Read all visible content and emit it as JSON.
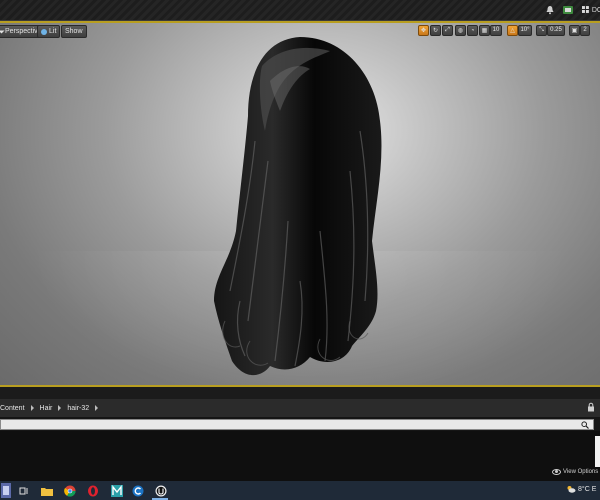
{
  "topbar": {
    "icons": [
      "bell-icon",
      "source-control-icon",
      "layout-icon"
    ],
    "layout_label": "DC"
  },
  "viewport": {
    "perspective_label": "Perspective",
    "lit_label": "Lit",
    "show_label": "Show",
    "grid_snap_value": "10",
    "rotation_snap_value": "10°",
    "scale_snap_value": "0.25",
    "camera_speed_value": "2",
    "colors": {
      "active_tool": "#f2a435",
      "border": "#b89e20"
    },
    "tool_icons": [
      "translate-icon",
      "rotate-icon",
      "scale-icon",
      "world-icon",
      "surface-snap-icon",
      "grid-icon",
      "angle-icon",
      "scale-snap-icon",
      "camera-speed-icon"
    ]
  },
  "content_browser": {
    "breadcrumb": [
      "Content",
      "Hair",
      "hair-32"
    ],
    "search_placeholder": "",
    "view_options_label": "View Options"
  },
  "taskbar": {
    "apps": [
      "windows-start-icon",
      "task-view-icon",
      "file-explorer-icon",
      "chrome-icon",
      "opera-icon",
      "app-m-icon",
      "app-c-icon",
      "unreal-engine-icon"
    ],
    "weather_temp": "8°C",
    "weather_extra": "E"
  }
}
